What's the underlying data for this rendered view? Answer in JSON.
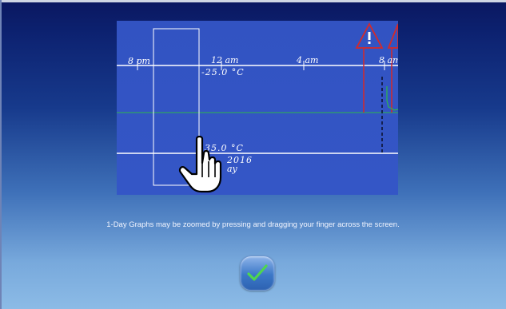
{
  "graph": {
    "time_labels": [
      "8 pm",
      "12 am",
      "4 am",
      "8 am"
    ],
    "upper_temp": "-25.0 °C",
    "lower_temp": "35.0 °C",
    "date_fragment": "2016",
    "day_fragment": "ay",
    "alarm_icon_left": "alert-icon",
    "alarm_icon_right": "alert-icon",
    "colors": {
      "background": "#3456c6",
      "gridline": "#ffffff",
      "midline": "#2db84a",
      "alarm": "#d42a2a",
      "trace": "#2db84a"
    }
  },
  "instruction": "1-Day Graphs may be zoomed by pressing and dragging your finger across the screen.",
  "confirm_button": {
    "icon": "checkmark-icon"
  }
}
